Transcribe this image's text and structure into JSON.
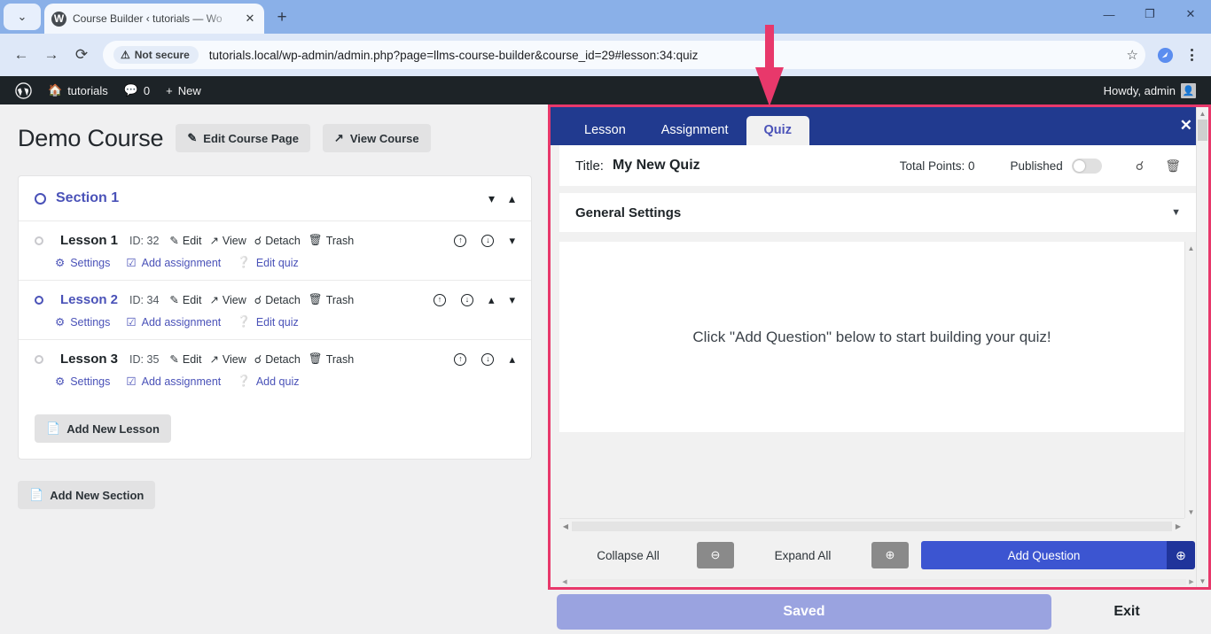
{
  "browser": {
    "tab": {
      "title": "Course Builder ‹ tutorials — Wo",
      "favicon": "wordpress-icon",
      "close": "✕"
    },
    "new_tab": "+",
    "tabstrip_caret": "⌄",
    "window_controls": {
      "minimize": "—",
      "maximize": "❐",
      "close": "✕"
    },
    "nav": {
      "back": "←",
      "forward": "→",
      "reload": "⟳"
    },
    "omnibox": {
      "security_label": "Not secure",
      "security_icon": "warning-triangle-icon",
      "url": "tutorials.local/wp-admin/admin.php?page=llms-course-builder&course_id=29#lesson:34:quiz",
      "star": "☆"
    },
    "extension_icon": "extension-icon",
    "menu": "kebab-menu-icon"
  },
  "wpbar": {
    "logo": "wordpress-logo-icon",
    "site": "tutorials",
    "comments_icon": "comment-bubble-icon",
    "comments_count": "0",
    "new_icon": "+",
    "new_label": "New",
    "howdy": "Howdy, admin",
    "avatar": "user-avatar-icon"
  },
  "builder": {
    "course_title": "Demo Course",
    "edit_course_page": "Edit Course Page",
    "edit_course_page_icon": "pencil-square-icon",
    "view_course": "View Course",
    "view_course_icon": "external-link-icon",
    "section": {
      "title": "Section 1",
      "collapse_down_icon": "chevron-down-icon",
      "collapse_up_icon": "chevron-up-icon"
    },
    "lesson_actions": {
      "id_prefix": "ID:",
      "edit": "Edit",
      "edit_icon": "pencil-square-icon",
      "view": "View",
      "view_icon": "external-link-icon",
      "detach": "Detach",
      "detach_icon": "broken-chain-icon",
      "trash": "Trash",
      "trash_icon": "trash-icon"
    },
    "sub_actions": {
      "settings": "Settings",
      "settings_icon": "gear-icon",
      "assignment_icon": "checkbox-icon",
      "quiz_icon": "question-circle-icon"
    },
    "lessons": [
      {
        "name": "Lesson 1",
        "id": "32",
        "selected": false,
        "assignment_label": "Add assignment",
        "quiz_label": "Edit quiz",
        "move_up": false,
        "move_down": true
      },
      {
        "name": "Lesson 2",
        "id": "34",
        "selected": true,
        "assignment_label": "Add assignment",
        "quiz_label": "Edit quiz",
        "move_up": true,
        "move_down": true
      },
      {
        "name": "Lesson 3",
        "id": "35",
        "selected": false,
        "assignment_label": "Add assignment",
        "quiz_label": "Add quiz",
        "move_up": true,
        "move_down": false
      }
    ],
    "add_new_lesson": "Add New Lesson",
    "add_new_lesson_icon": "page-icon",
    "add_new_section": "Add New Section",
    "add_new_section_icon": "page-icon"
  },
  "quiz_panel": {
    "tabs": [
      {
        "label": "Lesson",
        "active": false
      },
      {
        "label": "Assignment",
        "active": false
      },
      {
        "label": "Quiz",
        "active": true
      }
    ],
    "close_icon": "✕",
    "title_label": "Title:",
    "title_value": "My New Quiz",
    "total_points_label": "Total Points: 0",
    "published_label": "Published",
    "published_on": false,
    "detach_icon": "broken-chain-icon",
    "trash_icon": "trash-icon",
    "general_settings": "General Settings",
    "general_settings_caret": "caret-down-icon",
    "empty_message": "Click \"Add Question\" below to start building your quiz!",
    "footer": {
      "collapse_all": "Collapse All",
      "collapse_icon": "minus-circle-icon",
      "expand_all": "Expand All",
      "expand_icon": "plus-circle-icon",
      "add_question": "Add Question",
      "add_question_icon": "plus-circle-icon"
    }
  },
  "savebar": {
    "saved": "Saved",
    "exit": "Exit"
  },
  "annotation": {
    "arrow": "red-down-arrow",
    "highlight_color": "#e8386b"
  },
  "colors": {
    "nav_blue": "#213a8f",
    "accent_violet": "#4a52b8",
    "primary_button": "#3c55d1",
    "saved_button": "#9aa3e0",
    "annotation_red": "#e8386b"
  }
}
